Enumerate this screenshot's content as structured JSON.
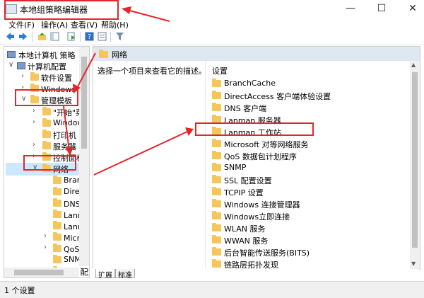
{
  "window": {
    "title": "本地组策略编辑器"
  },
  "controls": {
    "minimize": "—",
    "maximize": "☐",
    "close": "✕"
  },
  "menu": [
    "文件(F)",
    "操作(A)",
    "查看(V)",
    "帮助(H)"
  ],
  "tree": {
    "items": [
      {
        "label": "本地计算机 策略",
        "arrow": "",
        "icon": "computer-icon"
      },
      {
        "label": "计算机配置",
        "arrow": "∨",
        "icon": "computer-icon"
      },
      {
        "label": "软件设置",
        "arrow": "›",
        "icon": "folder-icon"
      },
      {
        "label": "Windows 设置",
        "arrow": "›",
        "icon": "folder-icon"
      },
      {
        "label": "管理模板",
        "arrow": "∨",
        "icon": "folder-icon"
      },
      {
        "label": "\"开始\"菜单",
        "arrow": "›",
        "icon": "folder-icon"
      },
      {
        "label": "Windows",
        "arrow": "›",
        "icon": "folder-icon"
      },
      {
        "label": "打印机",
        "arrow": "",
        "icon": "folder-icon"
      },
      {
        "label": "服务器",
        "arrow": "›",
        "icon": "folder-icon"
      },
      {
        "label": "控制面板",
        "arrow": "›",
        "icon": "folder-icon"
      },
      {
        "label": "网络",
        "arrow": "∨",
        "icon": "folder-icon"
      },
      {
        "label": "BranchCache",
        "arrow": "",
        "icon": "folder-icon"
      },
      {
        "label": "DirectAccess",
        "arrow": "",
        "icon": "folder-icon"
      },
      {
        "label": "DNS 客户端",
        "arrow": "",
        "icon": "folder-icon"
      },
      {
        "label": "Lanman 服务器",
        "arrow": "",
        "icon": "folder-icon"
      },
      {
        "label": "Lanman 工作站",
        "arrow": "",
        "icon": "folder-icon"
      },
      {
        "label": "Microsoft 对等网络服务",
        "arrow": "›",
        "icon": "folder-icon"
      },
      {
        "label": "QoS 数据包计划程序",
        "arrow": "›",
        "icon": "folder-icon"
      },
      {
        "label": "SNMP",
        "arrow": "",
        "icon": "folder-icon"
      },
      {
        "label": "SSL 配置设置",
        "arrow": "",
        "icon": "folder-icon"
      }
    ]
  },
  "content": {
    "header": "网络",
    "description": "选择一个项目来查看它的描述。",
    "column_header": "设置",
    "items": [
      "BranchCache",
      "DirectAccess 客户端体验设置",
      "DNS 客户端",
      "Lanman 服务器",
      "Lanman 工作站",
      "Microsoft 对等网络服务",
      "QoS 数据包计划程序",
      "SNMP",
      "SSL 配置设置",
      "TCPIP 设置",
      "Windows 连接管理器",
      "Windows立即连接",
      "WLAN 服务",
      "WWAN 服务",
      "后台智能传送服务(BITS)",
      "链路层拓扑发现"
    ]
  },
  "tabs": [
    "扩展",
    "标准"
  ],
  "status": "1 个设置",
  "colors": {
    "highlight": "#e3262b",
    "folder": "#f4c65b",
    "header_bg": "#dfe7f1"
  }
}
